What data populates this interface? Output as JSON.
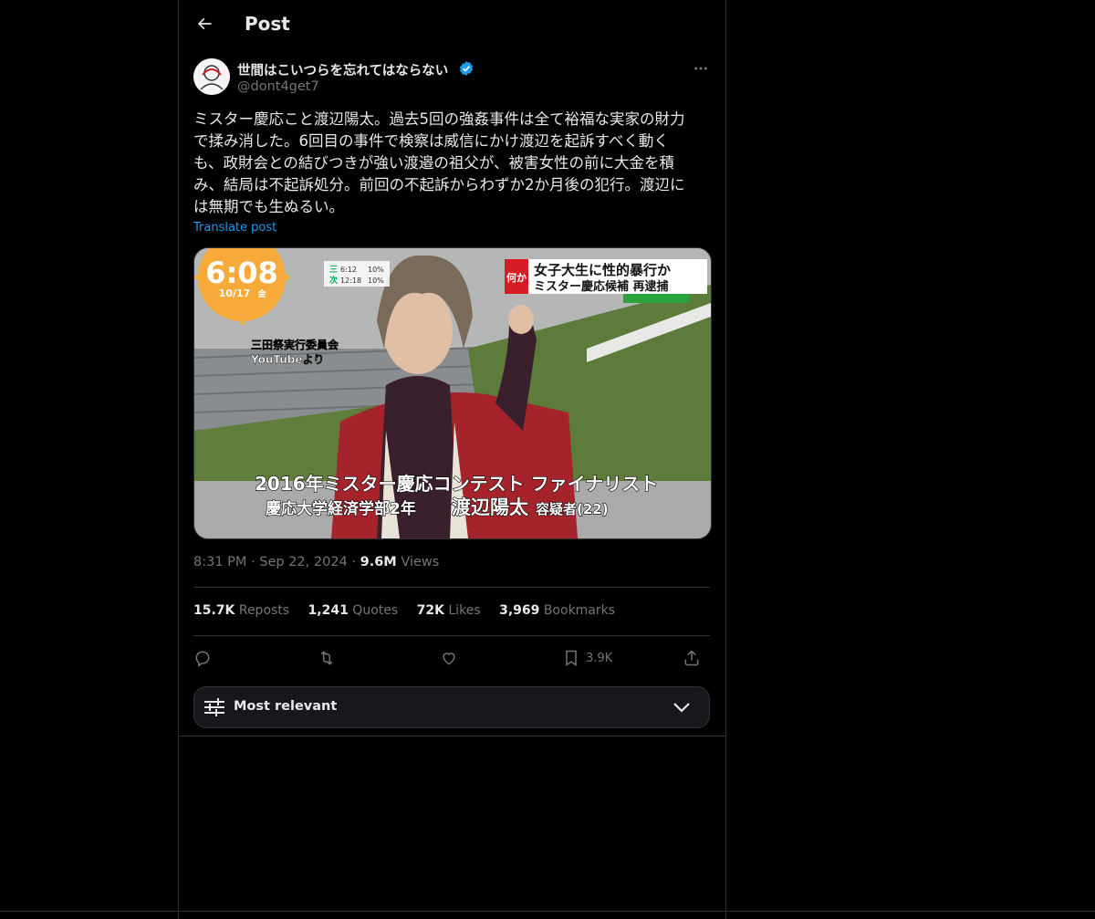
{
  "header": {
    "title": "Post"
  },
  "author": {
    "name": "世間はこいつらを忘れてはならない",
    "handle": "@dont4get7"
  },
  "tweet": {
    "text": "ミスター慶応こと渡辺陽太。過去5回の強姦事件は全て裕福な実家の財力\nで揉み消した。6回目の事件で検察は威信にかけ渡辺を起訴すべく動く\nも、政財会との結びつきが強い渡邉の祖父が、被害女性の前に大金を積\nみ、結局は不起訴処分。前回の不起訴からわずか2か月後の犯行。渡辺に\nは無期でも生ぬるい。",
    "translate": "Translate post"
  },
  "media": {
    "clock": "6:08",
    "date": "10/17",
    "date_day": "金",
    "ratings": [
      {
        "label": "三",
        "time": "6:12",
        "pct": "10%"
      },
      {
        "label": "次",
        "time": "12:18",
        "pct": "10%"
      }
    ],
    "headline_tag": "何か",
    "headline_line1": "女子大生に性的暴行か",
    "headline_line2": "ミスター慶応候補 再逮捕",
    "source_line1": "三田祭実行委員会",
    "source_line2": "YouTubeより",
    "caption_line1": "2016年ミスター慶応コンテスト ファイナリスト",
    "caption_line2_prefix": "慶応大学経済学部2年",
    "caption_name": "渡辺陽太",
    "caption_suffix": "容疑者(22)"
  },
  "meta": {
    "time": "8:31 PM",
    "sep1": "·",
    "date": "Sep 22, 2024",
    "sep2": "·",
    "views": "9.6M",
    "views_label": "Views"
  },
  "stats": {
    "reposts": "15.7K",
    "reposts_label": "Reposts",
    "quotes": "1,241",
    "quotes_label": "Quotes",
    "likes": "72K",
    "likes_label": "Likes",
    "bookmarks": "3,969",
    "bookmarks_label": "Bookmarks"
  },
  "actions": {
    "bookmark_count": "3.9K"
  },
  "sort": {
    "label": "Most relevant"
  },
  "colors": {
    "accent": "#1d9bf0",
    "background": "#000000",
    "muted": "#71767b",
    "border": "#2f3336"
  },
  "icons": [
    "back-arrow-icon",
    "verified-badge-icon",
    "more-icon",
    "reply-icon",
    "repost-icon",
    "like-icon",
    "bookmark-icon",
    "share-icon",
    "sliders-icon",
    "chevron-down-icon"
  ]
}
